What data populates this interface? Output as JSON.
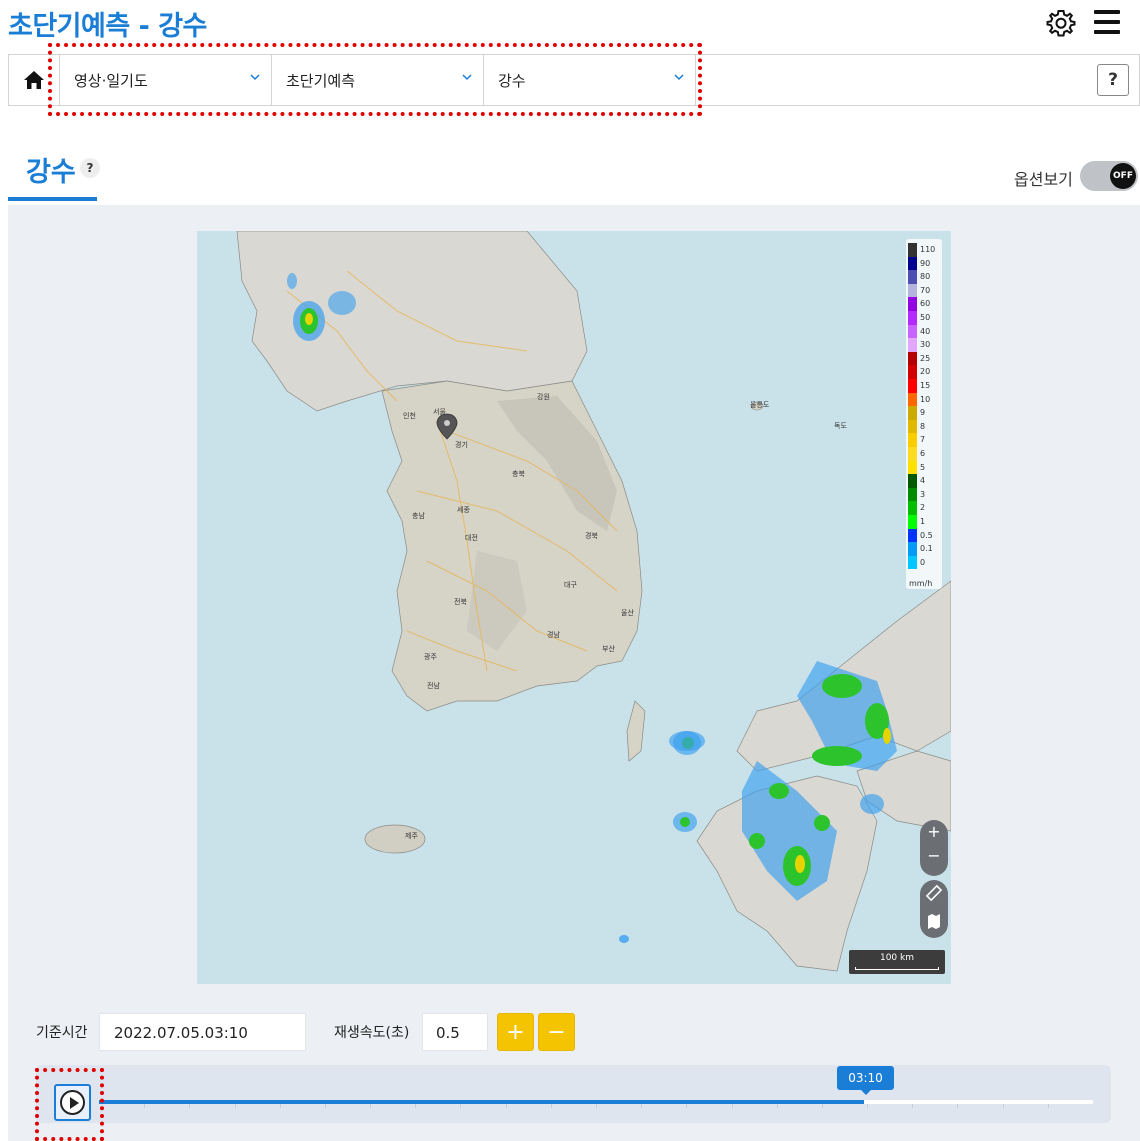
{
  "header": {
    "title": "초단기예측 - 강수",
    "icons": [
      "gear-icon",
      "hamburger-menu-icon"
    ]
  },
  "breadcrumb": {
    "home_icon": "home-icon",
    "items": [
      {
        "label": "영상·일기도"
      },
      {
        "label": "초단기예측"
      },
      {
        "label": "강수"
      }
    ],
    "help_label": "?"
  },
  "section": {
    "tab_label": "강수",
    "tab_help": "?",
    "option_label": "옵션보기",
    "option_toggle": "OFF"
  },
  "map": {
    "legend": {
      "unit": "mm/h",
      "values": [
        "110",
        "90",
        "80",
        "70",
        "60",
        "50",
        "40",
        "30",
        "25",
        "20",
        "15",
        "10",
        "9",
        "8",
        "7",
        "6",
        "5",
        "4",
        "3",
        "2",
        "1",
        "0.5",
        "0.1",
        "0"
      ],
      "colors": [
        "#333333",
        "#000390",
        "#4c4eb1",
        "#b3b4de",
        "#9300e4",
        "#b329ff",
        "#c963ff",
        "#e0a9ff",
        "#b40000",
        "#d20000",
        "#ff0000",
        "#ff6600",
        "#ccaa00",
        "#e0b900",
        "#f9cd00",
        "#ffdc1f",
        "#ffe100",
        "#005a00",
        "#008c00",
        "#00be00",
        "#00ff00",
        "#0033ff",
        "#009bf5",
        "#00c8ff"
      ]
    },
    "scale_label": "100 km",
    "zoom_in": "+",
    "zoom_out": "−",
    "place_labels": {
      "seoul": "서울",
      "gyeonggi": "경기",
      "gangwon": "강원",
      "chungbuk": "충북",
      "chungnam": "충남",
      "sejong": "세종",
      "daejeon": "대전",
      "gyeongbuk": "경북",
      "daegu": "대구",
      "jeonbuk": "전북",
      "gwangju": "광주",
      "jeonnam": "전남",
      "gyeongnam": "경남",
      "ulsan": "울산",
      "busan": "부산",
      "incheon": "인천",
      "ulleungdo": "울릉도",
      "dokdo": "독도",
      "jeju": "제주"
    }
  },
  "controls": {
    "base_time_label": "기준시간",
    "base_time_value": "2022.07.05.03:10",
    "speed_label": "재생속도(초)",
    "speed_value": "0.5",
    "plus_label": "+",
    "minus_label": "−"
  },
  "timeline": {
    "current_time": "03:10",
    "progress_fraction": 0.77,
    "play_icon": "play-icon"
  },
  "colors": {
    "accent": "#1b7ed6",
    "button_yellow": "#f5c400",
    "highlight_red": "#e00000"
  }
}
